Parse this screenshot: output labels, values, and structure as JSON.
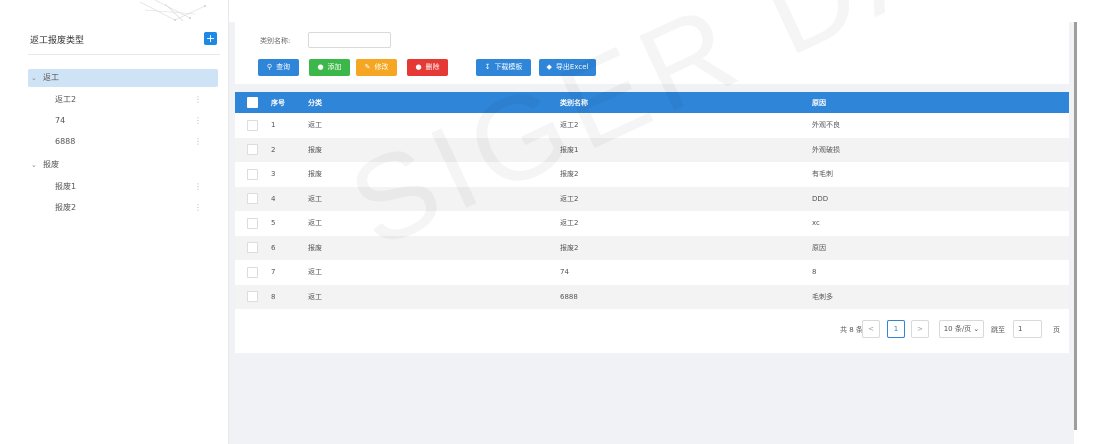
{
  "sidebar": {
    "title": "返工报废类型",
    "add_icon": "plus-icon",
    "tree": [
      {
        "label": "返工",
        "expanded": true,
        "selected": true,
        "children": [
          "返工2",
          "74",
          "6888"
        ]
      },
      {
        "label": "报废",
        "expanded": true,
        "selected": false,
        "children": [
          "报废1",
          "报废2"
        ]
      }
    ]
  },
  "search": {
    "label": "类别名称:",
    "value": "",
    "placeholder": ""
  },
  "toolbar": {
    "query": "查询",
    "add": "添加",
    "edit": "修改",
    "delete": "删除",
    "download": "下载模板",
    "export": "导出Excel"
  },
  "table": {
    "headers": [
      "序号",
      "分类",
      "类别名称",
      "原因"
    ],
    "rows": [
      [
        "1",
        "返工",
        "返工2",
        "外观不良"
      ],
      [
        "2",
        "报废",
        "报废1",
        "外观破损"
      ],
      [
        "3",
        "报废",
        "报废2",
        "有毛刺"
      ],
      [
        "4",
        "返工",
        "返工2",
        "DDD"
      ],
      [
        "5",
        "返工",
        "返工2",
        "xc"
      ],
      [
        "6",
        "报废",
        "报废2",
        "原因"
      ],
      [
        "7",
        "返工",
        "74",
        "8"
      ],
      [
        "8",
        "返工",
        "6888",
        "毛刺多"
      ]
    ]
  },
  "pagination": {
    "total": "共 8 条",
    "prev": "<",
    "current_page": "1",
    "next": ">",
    "page_size": "10 条/页",
    "goto_label": "跳至",
    "goto_value": "1",
    "goto_suffix": "页"
  },
  "watermark": "SIGER DATA",
  "colors": {
    "primary": "#2f86d9",
    "green": "#3cb84a",
    "orange": "#f5a623",
    "red": "#e53935"
  }
}
